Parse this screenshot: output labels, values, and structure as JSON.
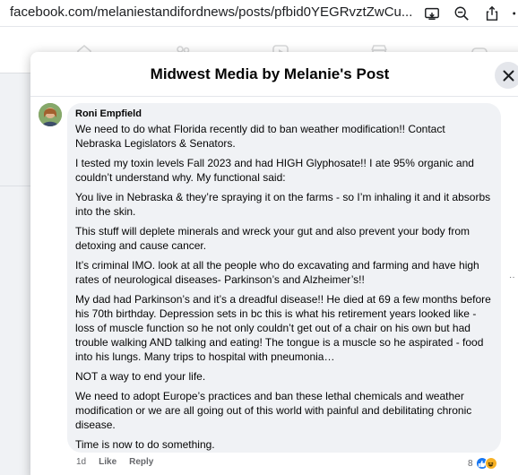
{
  "browser": {
    "url": "facebook.com/melaniestandifordnews/posts/pfbid0YEGRvztZwCu..."
  },
  "modal": {
    "title": "Midwest Media by Melanie's Post"
  },
  "comment": {
    "author": "Roni Empfield",
    "paragraphs": [
      "We need to do what Florida recently did to ban weather modification!! Contact Nebraska Legislators & Senators.",
      "I tested my toxin levels Fall 2023 and had HIGH Glyphosate!! I ate 95% organic and couldn’t understand why. My functional said:",
      "You live in Nebraska & they’re spraying it on the farms - so I’m inhaling it and it absorbs into the skin.",
      "This stuff will deplete minerals and wreck your gut and also prevent your body from detoxing and cause cancer.",
      "It’s criminal IMO. look at all the people who do excavating and farming and have high rates of neurological diseases- Parkinson’s and Alzheimer’s!!",
      "My dad had Parkinson’s and it’s a dreadful disease!! He died at 69 a few months before his 70th birthday. Depression sets in bc this is what his retirement years looked like - loss of muscle function so he not only couldn’t get out of a chair on his own but had trouble walking AND talking and eating! The tongue is a muscle so he aspirated - food into his lungs. Many trips to hospital with pneumonia…",
      "NOT a way to end your life.",
      "We need to adopt Europe’s practices and ban these lethal chemicals and weather modification or we are all going out of this world with painful and debilitating chronic disease.",
      "Time is now to do something."
    ],
    "time": "1d",
    "like_label": "Like",
    "reply_label": "Reply",
    "reaction_count": "8"
  },
  "icons": {
    "browser": [
      "cast-icon",
      "zoom-out-icon",
      "share-icon",
      "more-icon"
    ],
    "close": "close-icon",
    "reactions": [
      "like-reaction-icon",
      "haha-reaction-icon"
    ]
  },
  "colors": {
    "bubble": "#f0f2f5",
    "like_blue": "#1877f2",
    "haha_yellow": "#f7b125",
    "secondary_text": "#65676b"
  }
}
